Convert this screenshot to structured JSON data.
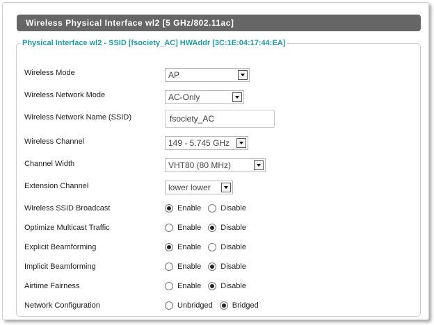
{
  "window_title": "Wireless Physical Interface wl2 [5 GHz/802.11ac]",
  "fieldset_legend": "Physical Interface wl2 - SSID [fsociety_AC] HWAddr [3C:1E:04:17:44:EA]",
  "fields": {
    "wireless_mode": {
      "label": "Wireless Mode",
      "value": "AP"
    },
    "network_mode": {
      "label": "Wireless Network Mode",
      "value": "AC-Only"
    },
    "ssid": {
      "label": "Wireless Network Name (SSID)",
      "value": "fsociety_AC"
    },
    "channel": {
      "label": "Wireless Channel",
      "value": "149 - 5.745 GHz"
    },
    "channel_width": {
      "label": "Channel Width",
      "value": "VHT80 (80 MHz)"
    },
    "extension_channel": {
      "label": "Extension Channel",
      "value": "lower lower"
    },
    "ssid_broadcast": {
      "label": "Wireless SSID Broadcast",
      "option_a": "Enable",
      "option_b": "Disable",
      "selected": "Enable"
    },
    "multicast": {
      "label": "Optimize Multicast Traffic",
      "option_a": "Enable",
      "option_b": "Disable",
      "selected": "Disable"
    },
    "explicit_bf": {
      "label": "Explicit Beamforming",
      "option_a": "Enable",
      "option_b": "Disable",
      "selected": "Enable"
    },
    "implicit_bf": {
      "label": "Implicit Beamforming",
      "option_a": "Enable",
      "option_b": "Disable",
      "selected": "Disable"
    },
    "airtime": {
      "label": "Airtime Fairness",
      "option_a": "Enable",
      "option_b": "Disable",
      "selected": "Disable"
    },
    "net_config": {
      "label": "Network Configuration",
      "option_a": "Unbridged",
      "option_b": "Bridged",
      "selected": "Bridged"
    }
  },
  "colors": {
    "title_bar": "#666666",
    "legend_text": "#1a9ea8"
  }
}
